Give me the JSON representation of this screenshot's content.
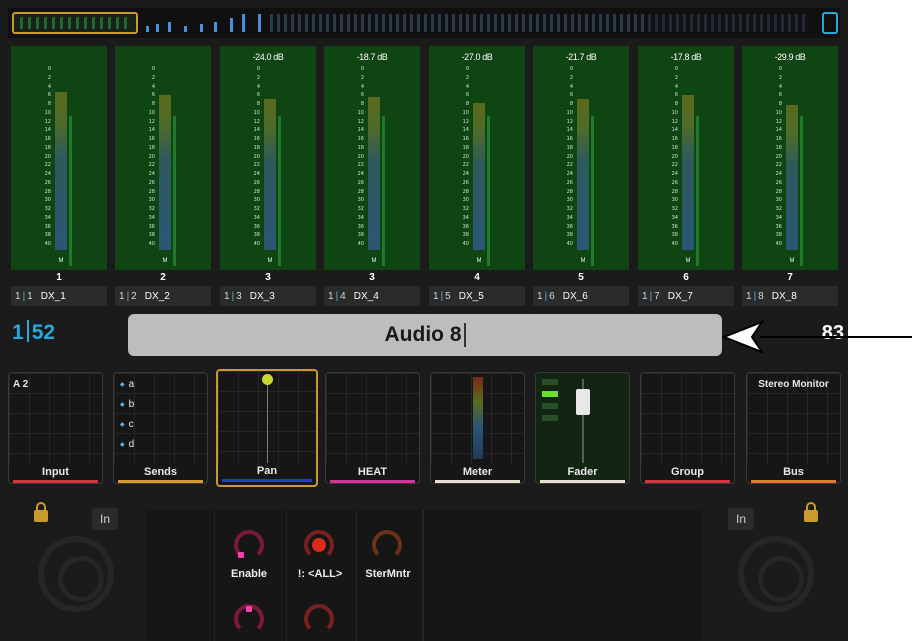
{
  "mixer": {
    "channels": [
      {
        "number": "1",
        "index_a": "1",
        "index_b": "1",
        "name": "DX_1",
        "peak": "",
        "level": 0.86
      },
      {
        "number": "2",
        "index_a": "1",
        "index_b": "2",
        "name": "DX_2",
        "peak": "",
        "level": 0.84
      },
      {
        "number": "3",
        "index_a": "1",
        "index_b": "3",
        "name": "DX_3",
        "peak": "-24.0 dB",
        "level": 0.82
      },
      {
        "number": "3",
        "index_a": "1",
        "index_b": "4",
        "name": "DX_4",
        "peak": "-18.7 dB",
        "level": 0.83
      },
      {
        "number": "4",
        "index_a": "1",
        "index_b": "5",
        "name": "DX_5",
        "peak": "-27.0 dB",
        "level": 0.8
      },
      {
        "number": "5",
        "index_a": "1",
        "index_b": "6",
        "name": "DX_6",
        "peak": "-21.7 dB",
        "level": 0.82
      },
      {
        "number": "6",
        "index_a": "1",
        "index_b": "7",
        "name": "DX_7",
        "peak": "-17.8 dB",
        "level": 0.84
      },
      {
        "number": "7",
        "index_a": "1",
        "index_b": "8",
        "name": "DX_8",
        "peak": "-29.9 dB",
        "level": 0.79
      }
    ],
    "meter_scale": [
      "0",
      "2",
      "4",
      "6",
      "8",
      "10",
      "12",
      "14",
      "16",
      "18",
      "20",
      "22",
      "24",
      "26",
      "28",
      "30",
      "32",
      "34",
      "36",
      "38",
      "40"
    ],
    "meter_foot": "M"
  },
  "track_row": {
    "bank_left": "1",
    "bank_right": "52",
    "track_name": "Audio 8",
    "count": "83"
  },
  "modules": [
    {
      "label": "Input",
      "top_text": "A 2",
      "color": "#d8323c"
    },
    {
      "label": "Sends",
      "sends": [
        "a",
        "b",
        "c",
        "d"
      ],
      "color": "#d89a2e"
    },
    {
      "label": "Pan",
      "color": "#2438d8",
      "selected": true
    },
    {
      "label": "HEAT",
      "color": "#d8329a"
    },
    {
      "label": "Meter",
      "color": "#e8e0d0"
    },
    {
      "label": "Fader",
      "color": "#e8e0d0"
    },
    {
      "label": "Group",
      "color": "#d8323c"
    },
    {
      "label": "Bus",
      "top_text": "Stereo Monitor",
      "color": "#e07a2e"
    }
  ],
  "bottom": {
    "in_left": "In",
    "in_right": "In",
    "quick_controls": [
      {
        "label": "Enable",
        "knob_color": "magenta"
      },
      {
        "label": "!: <ALL>",
        "knob_color": "red"
      },
      {
        "label": "SterMntr",
        "knob_color": "orange"
      }
    ]
  },
  "icons": {
    "lock": "lock-icon",
    "arrow": "callout-arrow-icon"
  },
  "colors": {
    "accent_blue": "#2aa7d8",
    "selection_gold": "#c99a2e",
    "meter_green": "#0f4413"
  }
}
